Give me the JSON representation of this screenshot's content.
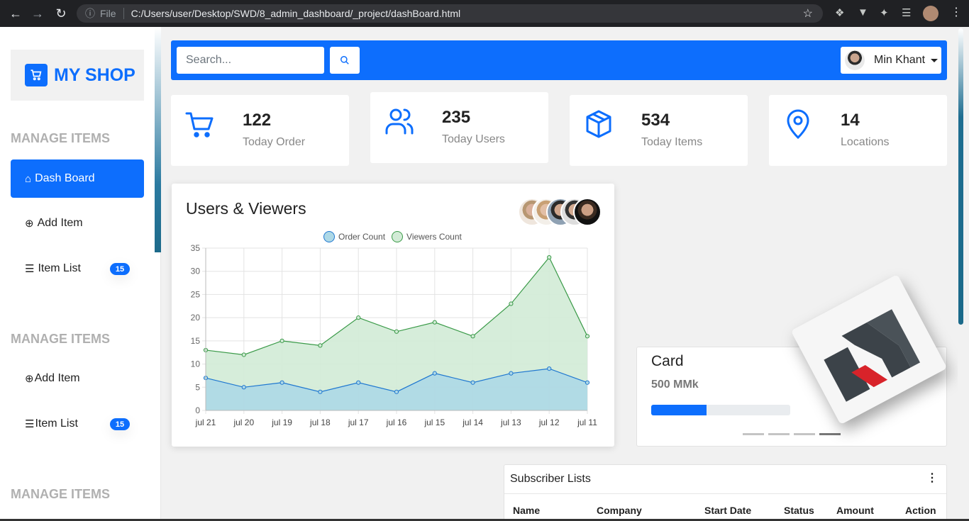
{
  "browser": {
    "protocol_label": "File",
    "url": "C:/Users/user/Desktop/SWD/8_admin_dashboard/_project/dashBoard.html"
  },
  "sidebar": {
    "brand": "MY SHOP",
    "sections": [
      {
        "title": "MANAGE ITEMS",
        "items": [
          {
            "label": "Dash Board",
            "icon": "home-icon",
            "active": true
          },
          {
            "label": "Add Item",
            "icon": "plus-circle-icon"
          },
          {
            "label": "Item List",
            "icon": "list-icon",
            "badge": "15"
          }
        ]
      },
      {
        "title": "MANAGE ITEMS",
        "items": [
          {
            "label": "Add Item",
            "icon": "plus-circle-icon"
          },
          {
            "label": "Item List",
            "icon": "list-icon",
            "badge": "15"
          }
        ]
      },
      {
        "title": "MANAGE ITEMS",
        "items": []
      }
    ]
  },
  "topbar": {
    "search_placeholder": "Search...",
    "user_name": "Min Khant"
  },
  "stats": [
    {
      "value": "122",
      "label": "Today Order",
      "icon": "cart-icon"
    },
    {
      "value": "235",
      "label": "Today Users",
      "icon": "users-icon"
    },
    {
      "value": "534",
      "label": "Today Items",
      "icon": "box-icon"
    },
    {
      "value": "14",
      "label": "Locations",
      "icon": "location-pin-icon"
    }
  ],
  "chart_card": {
    "title": "Users & Viewers"
  },
  "chart_data": {
    "type": "area",
    "categories": [
      "jul 21",
      "jul 20",
      "jul 19",
      "jul 18",
      "jul 17",
      "jul 16",
      "jul 15",
      "jul 14",
      "jul 13",
      "jul 12",
      "jul 11"
    ],
    "series": [
      {
        "name": "Order Count",
        "values": [
          7,
          5,
          6,
          4,
          6,
          4,
          8,
          6,
          8,
          9,
          6
        ],
        "color": "#1f77d0",
        "fill": "#add8e6"
      },
      {
        "name": "Viewers Count",
        "values": [
          13,
          12,
          15,
          14,
          20,
          17,
          19,
          16,
          23,
          33,
          16
        ],
        "color": "#3a9a48",
        "fill": "#d2ebd6"
      }
    ],
    "ylim": [
      0,
      35
    ],
    "yticks": [
      0,
      5,
      10,
      15,
      20,
      25,
      30,
      35
    ],
    "grid": true,
    "legend": "top-center"
  },
  "card": {
    "title": "Card",
    "value": "500 MMk",
    "progress": 0.4
  },
  "subscribers": {
    "title": "Subscriber Lists",
    "columns": [
      "Name",
      "Company",
      "Start Date",
      "Status",
      "Amount",
      "Action"
    ]
  },
  "colors": {
    "accent": "#0d6efd"
  }
}
